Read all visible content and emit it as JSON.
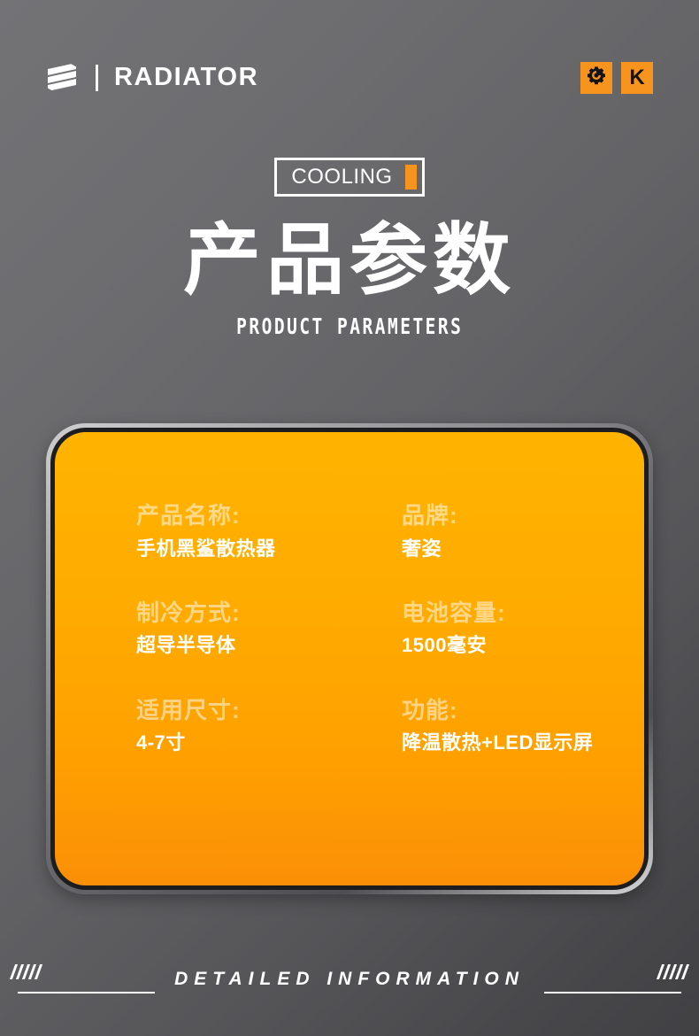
{
  "header": {
    "brand_mark_icon": "hexagon-s-logo-icon",
    "brand_name": "RADIATOR",
    "actions": [
      {
        "icon": "gear-icon",
        "label": ""
      },
      {
        "icon": "letter-k-icon",
        "label": "K"
      }
    ]
  },
  "title_block": {
    "badge_text": "COOLING",
    "main_title": "产品参数",
    "sub_title": "PRODUCT PARAMETERS"
  },
  "card": {
    "specs": [
      {
        "label": "产品名称:",
        "value": "手机黑鲨散热器"
      },
      {
        "label": "品牌:",
        "value": "奢姿"
      },
      {
        "label": "制冷方式:",
        "value": "超导半导体"
      },
      {
        "label": "电池容量:",
        "value": "1500毫安"
      },
      {
        "label": "适用尺寸:",
        "value": "4-7寸"
      },
      {
        "label": "功能:",
        "value": "降温散热+LED显示屏"
      }
    ]
  },
  "footer": {
    "text": "DETAILED INFORMATION"
  },
  "colors": {
    "accent_orange": "#f7941d",
    "card_orange_top": "#ffb300",
    "card_orange_bottom": "#fb8f07",
    "background_light": "#737376",
    "background_dark": "#414144",
    "text_white": "#ffffff"
  }
}
